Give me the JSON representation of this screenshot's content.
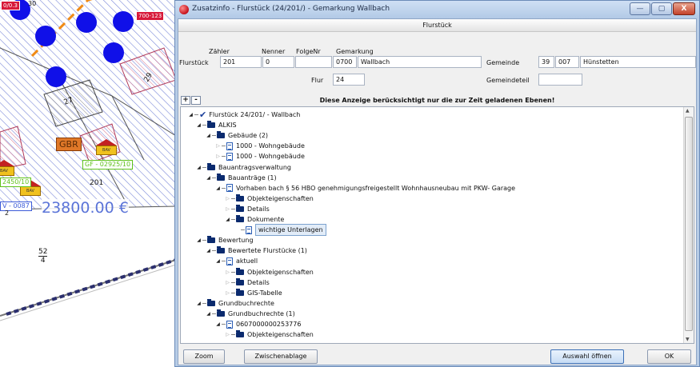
{
  "map": {
    "tags": {
      "red_top_left": "0/0.3",
      "red_top_mid": "30",
      "red_top_right": "700-123",
      "green_right": "GF - 02925/10",
      "green_left": "2450/10",
      "blue_left": "V - 0087"
    },
    "numbers": [
      "29",
      "27",
      "201",
      "2"
    ],
    "gbr": "GBR",
    "bav_label": "BAV",
    "price": "23800.00 €",
    "fraction": {
      "num": "52",
      "den": "4"
    }
  },
  "window": {
    "title": "Zusatzinfo - Flurstück (24/201/) - Gemarkung Wallbach",
    "caption_buttons": [
      "—",
      "▢",
      "X"
    ],
    "header": "Flurstück",
    "form": {
      "col_zaehler": "Zähler",
      "col_nenner": "Nenner",
      "col_folgenr": "FolgeNr",
      "col_gemarkung": "Gemarkung",
      "label_flurstueck": "Flurstück",
      "zaehler": "201",
      "nenner": "0",
      "folgenr": "",
      "gemarkung_nr": "0700",
      "gemarkung_name": "Wallbach",
      "label_flur": "Flur",
      "flur": "24",
      "label_gemeinde": "Gemeinde",
      "gemeinde_a": "39",
      "gemeinde_b": "007",
      "gemeinde_name": "Hünstetten",
      "label_gemeindeteil": "Gemeindeteil",
      "gemeindeteil": ""
    },
    "expand_all": "+",
    "collapse_all": "-",
    "notice": "Diese Anzeige berücksichtigt nur die zur Zeit geladenen Ebenen!",
    "tree": [
      {
        "label": "Flurstück 24/201/ - Wallbach",
        "icon": "check-icon",
        "level": 0,
        "state": "open"
      },
      {
        "label": "ALKIS",
        "icon": "folder-icon",
        "level": 1,
        "state": "open"
      },
      {
        "label": "Gebäude (2)",
        "icon": "folder-icon",
        "level": 2,
        "state": "open"
      },
      {
        "label": "1000 - Wohngebäude",
        "icon": "document-icon",
        "level": 3,
        "state": "closed"
      },
      {
        "label": "1000 - Wohngebäude",
        "icon": "document-icon",
        "level": 3,
        "state": "closed"
      },
      {
        "label": "Bauantragsverwaltung",
        "icon": "folder-icon",
        "level": 1,
        "state": "open"
      },
      {
        "label": "Bauanträge (1)",
        "icon": "folder-icon",
        "level": 2,
        "state": "open"
      },
      {
        "label": "Vorhaben bach § 56 HBO genehmigungsfreigestellt Wohnhausneubau mit PKW- Garage",
        "icon": "document-icon",
        "level": 3,
        "state": "open"
      },
      {
        "label": "Objekteigenschaften",
        "icon": "folder-icon",
        "level": 4,
        "state": "closed"
      },
      {
        "label": "Details",
        "icon": "folder-icon",
        "level": 4,
        "state": "closed"
      },
      {
        "label": "Dokumente",
        "icon": "folder-icon",
        "level": 4,
        "state": "open"
      },
      {
        "label": "wichtige Unterlagen",
        "icon": "document-icon",
        "level": 5,
        "state": "leaf",
        "selected": true
      },
      {
        "label": "Bewertung",
        "icon": "folder-icon",
        "level": 1,
        "state": "open"
      },
      {
        "label": "Bewertete Flurstücke (1)",
        "icon": "folder-icon",
        "level": 2,
        "state": "open"
      },
      {
        "label": "aktuell",
        "icon": "document-icon",
        "level": 3,
        "state": "open"
      },
      {
        "label": "Objekteigenschaften",
        "icon": "folder-icon",
        "level": 4,
        "state": "closed"
      },
      {
        "label": "Details",
        "icon": "folder-icon",
        "level": 4,
        "state": "closed"
      },
      {
        "label": "GIS-Tabelle",
        "icon": "folder-icon",
        "level": 4,
        "state": "closed"
      },
      {
        "label": "Grundbuchrechte",
        "icon": "folder-icon",
        "level": 1,
        "state": "open"
      },
      {
        "label": "Grundbuchrechte (1)",
        "icon": "folder-icon",
        "level": 2,
        "state": "open"
      },
      {
        "label": "0607000000253776",
        "icon": "document-icon",
        "level": 3,
        "state": "open"
      },
      {
        "label": "Objekteigenschaften",
        "icon": "folder-icon",
        "level": 4,
        "state": "closed"
      }
    ],
    "buttons": {
      "zoom": "Zoom",
      "zwischenablage": "Zwischenablage",
      "auswahl": "Auswahl öffnen",
      "ok": "OK"
    }
  }
}
